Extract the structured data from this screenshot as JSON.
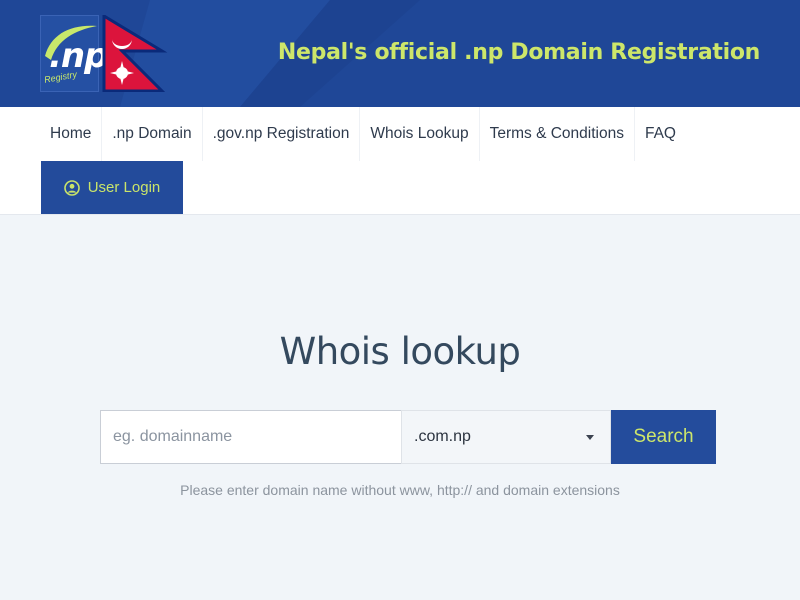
{
  "header": {
    "logo_text": ".np",
    "logo_subtext": "Registry",
    "tagline": "Nepal's official .np Domain Registration",
    "colors": {
      "background": "#1f4797",
      "accent": "#cde66a"
    }
  },
  "nav": {
    "items": [
      {
        "label": "Home"
      },
      {
        "label": ".np Domain"
      },
      {
        "label": ".gov.np Registration"
      },
      {
        "label": "Whois Lookup"
      },
      {
        "label": "Terms & Conditions"
      },
      {
        "label": "FAQ"
      }
    ],
    "login": {
      "label": "User Login",
      "icon": "user-circle-icon"
    }
  },
  "main": {
    "title": "Whois lookup",
    "search": {
      "placeholder": "eg. domainname",
      "value": "",
      "tld_selected": ".com.np",
      "button_label": "Search"
    },
    "hint": "Please enter domain name without www, http:// and domain extensions"
  }
}
